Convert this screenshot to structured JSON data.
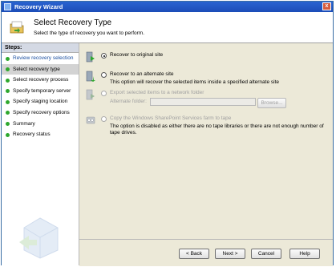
{
  "window": {
    "title": "Recovery Wizard",
    "close_glyph": "x"
  },
  "header": {
    "title": "Select Recovery Type",
    "subtitle": "Select the type of recovery you want to perform."
  },
  "steps": {
    "heading": "Steps:",
    "items": [
      {
        "label": "Review recovery selection",
        "state": "done"
      },
      {
        "label": "Select recovery type",
        "state": "current"
      },
      {
        "label": "Select recovery process",
        "state": "pending"
      },
      {
        "label": "Specify temporary server",
        "state": "pending"
      },
      {
        "label": "Specify staging location",
        "state": "pending"
      },
      {
        "label": "Specify recovery options",
        "state": "pending"
      },
      {
        "label": "Summary",
        "state": "pending"
      },
      {
        "label": "Recovery status",
        "state": "pending"
      }
    ]
  },
  "options": {
    "original": {
      "label": "Recover to original site",
      "selected": true,
      "enabled": true
    },
    "alternate": {
      "label": "Recover to an alternate site",
      "description": "This option will recover the selected items inside a specified alternate site",
      "selected": false,
      "enabled": true
    },
    "network": {
      "label": "Export selected items to a network folder",
      "folder_label": "Alternate folder:",
      "folder_value": "",
      "browse_label": "Browse...",
      "selected": false,
      "enabled": false
    },
    "tape": {
      "label": "Copy the Windows SharePoint Services farm to tape",
      "description": "The option is disabled as either there are no tape libraries or there are not enough number of tape drives.",
      "selected": false,
      "enabled": false
    }
  },
  "footer": {
    "back": "< Back",
    "next": "Next >",
    "cancel": "Cancel",
    "help": "Help"
  },
  "colors": {
    "titlebar": "#2a63d0",
    "step_done": "#1a4ea0",
    "step_dot": "#2ea82e",
    "disabled_text": "#a0a0a0"
  }
}
